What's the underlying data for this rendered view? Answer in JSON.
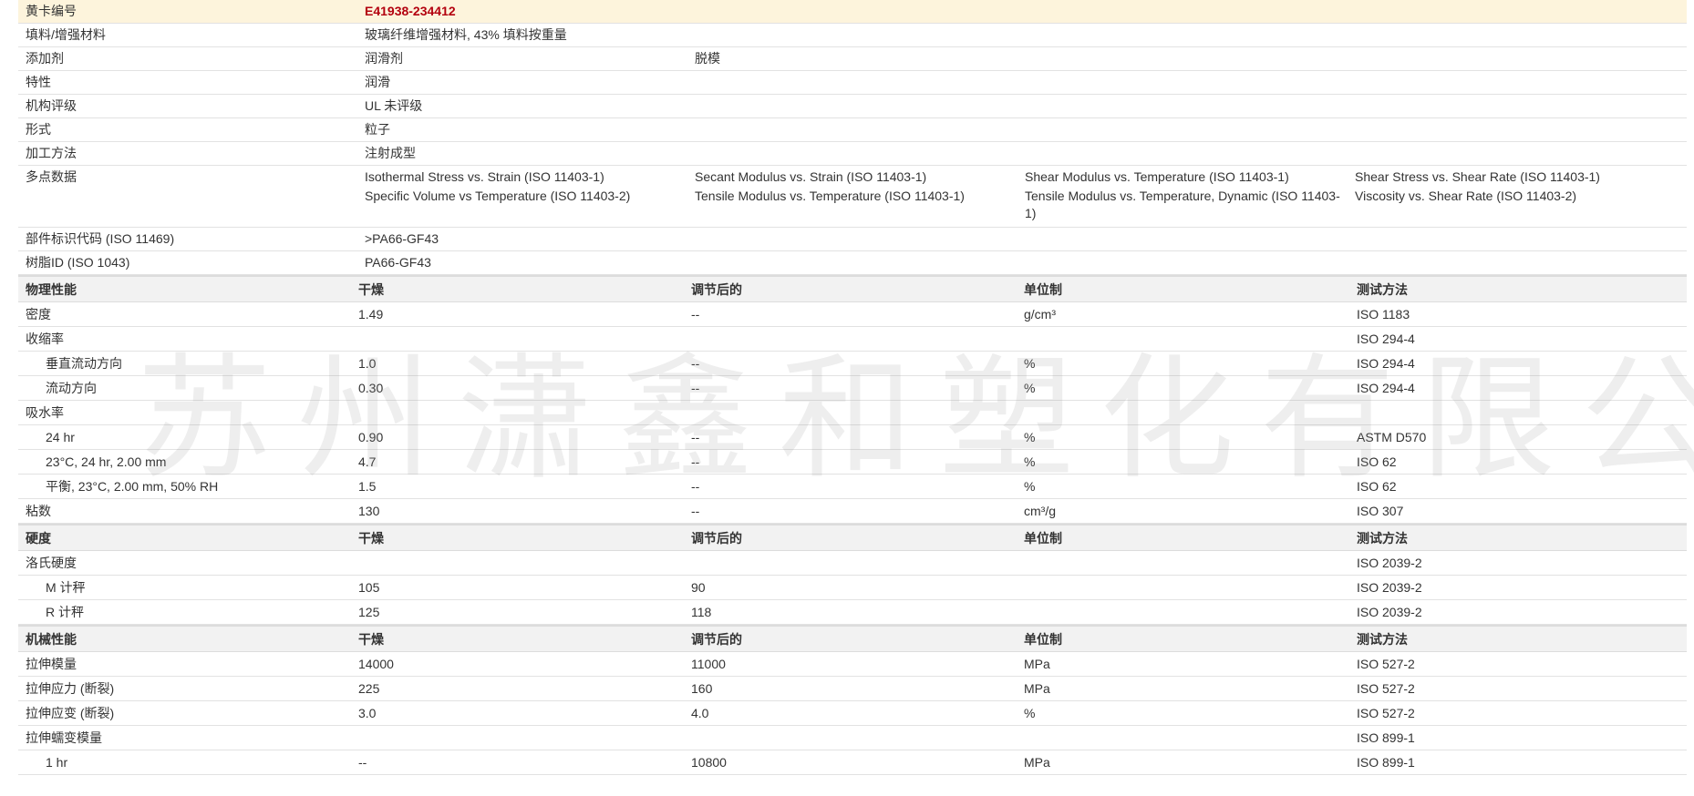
{
  "info": {
    "card_label": "黄卡编号",
    "card_value": "E41938-234412",
    "filler_label": "填料/增强材料",
    "filler_value": "玻璃纤维增强材料, 43% 填料按重量",
    "additive_label": "添加剂",
    "additive_values": [
      "润滑剂",
      "脱模"
    ],
    "feature_label": "特性",
    "feature_value": "润滑",
    "agency_label": "机构评级",
    "agency_value": "UL 未评级",
    "form_label": "形式",
    "form_value": "粒子",
    "process_label": "加工方法",
    "process_value": "注射成型",
    "multipoint_label": "多点数据",
    "multipoint_values": [
      "Isothermal Stress vs. Strain (ISO 11403-1)",
      "Secant Modulus vs. Strain (ISO 11403-1)",
      "Shear Modulus vs. Temperature (ISO 11403-1)",
      "Shear Stress vs. Shear Rate (ISO 11403-1)",
      "Specific Volume vs Temperature (ISO 11403-2)",
      "Tensile Modulus vs. Temperature (ISO 11403-1)",
      "Tensile Modulus vs. Temperature, Dynamic (ISO 11403-1)",
      "Viscosity vs. Shear Rate (ISO 11403-2)"
    ],
    "part_code_label": "部件标识代码 (ISO 11469)",
    "part_code_value": ">PA66-GF43",
    "resin_id_label": "树脂ID (ISO 1043)",
    "resin_id_value": "PA66-GF43"
  },
  "sections": {
    "physical": {
      "header": [
        "物理性能",
        "干燥",
        "调节后的",
        "单位制",
        "测试方法"
      ],
      "rows": [
        [
          "密度",
          "1.49",
          "--",
          "g/cm³",
          "ISO 1183"
        ],
        [
          "收缩率",
          "",
          "",
          "",
          "ISO 294-4"
        ],
        [
          "垂直流动方向",
          "1.0",
          "--",
          "%",
          "ISO 294-4"
        ],
        [
          "流动方向",
          "0.30",
          "--",
          "%",
          "ISO 294-4"
        ],
        [
          "吸水率",
          "",
          "",
          "",
          ""
        ],
        [
          "24 hr",
          "0.90",
          "--",
          "%",
          "ASTM D570"
        ],
        [
          "23°C, 24 hr, 2.00 mm",
          "4.7",
          "--",
          "%",
          "ISO 62"
        ],
        [
          "平衡, 23°C, 2.00 mm, 50% RH",
          "1.5",
          "--",
          "%",
          "ISO 62"
        ],
        [
          "粘数",
          "130",
          "--",
          "cm³/g",
          "ISO 307"
        ]
      ]
    },
    "hardness": {
      "header": [
        "硬度",
        "干燥",
        "调节后的",
        "单位制",
        "测试方法"
      ],
      "rows": [
        [
          "洛氏硬度",
          "",
          "",
          "",
          "ISO 2039-2"
        ],
        [
          "M 计秤",
          "105",
          "90",
          "",
          "ISO 2039-2"
        ],
        [
          "R 计秤",
          "125",
          "118",
          "",
          "ISO 2039-2"
        ]
      ]
    },
    "mechanical": {
      "header": [
        "机械性能",
        "干燥",
        "调节后的",
        "单位制",
        "测试方法"
      ],
      "rows": [
        [
          "拉伸模量",
          "14000",
          "11000",
          "MPa",
          "ISO 527-2"
        ],
        [
          "拉伸应力 (断裂)",
          "225",
          "160",
          "MPa",
          "ISO 527-2"
        ],
        [
          "拉伸应变 (断裂)",
          "3.0",
          "4.0",
          "%",
          "ISO 527-2"
        ],
        [
          "拉伸蠕变模量",
          "",
          "",
          "",
          "ISO 899-1"
        ],
        [
          "1 hr",
          "--",
          "10800",
          "MPa",
          "ISO 899-1"
        ]
      ]
    }
  },
  "watermark": "苏州潇鑫和塑化有限公司"
}
